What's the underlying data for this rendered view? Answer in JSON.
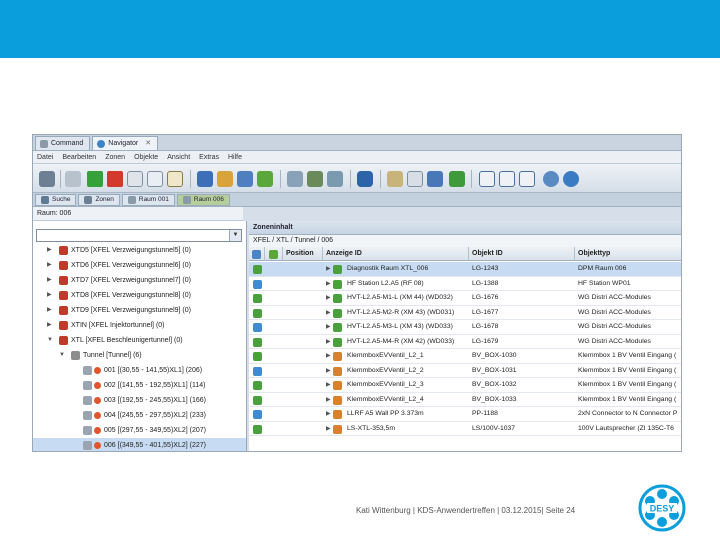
{
  "window_tabs": [
    {
      "label": "Command",
      "active": false
    },
    {
      "label": "Navigator",
      "active": true
    }
  ],
  "menu": [
    "Datei",
    "Bearbeiten",
    "Zonen",
    "Objekte",
    "Ansicht",
    "Extras",
    "Hilfe"
  ],
  "view_tabs": [
    {
      "label": "Suche",
      "active": false
    },
    {
      "label": "Zonen",
      "active": false
    },
    {
      "label": "Raum 001",
      "active": false
    },
    {
      "label": "Raum 006",
      "active": true
    }
  ],
  "breadcrumb": "Raum: 006",
  "tree": [
    {
      "label": "XTD5 [XFEL Verzweigungstunnel5] (0)",
      "level": 0,
      "expanded": false,
      "selected": false
    },
    {
      "label": "XTD6 [XFEL Verzweigungstunnel6] (0)",
      "level": 0,
      "expanded": false,
      "selected": false
    },
    {
      "label": "XTD7 [XFEL Verzweigungstunnel7] (0)",
      "level": 0,
      "expanded": false,
      "selected": false
    },
    {
      "label": "XTD8 [XFEL Verzweigungstunnel8] (0)",
      "level": 0,
      "expanded": false,
      "selected": false
    },
    {
      "label": "XTD9 [XFEL Verzweigungstunnel9] (0)",
      "level": 0,
      "expanded": false,
      "selected": false
    },
    {
      "label": "XTIN [XFEL Injektortunnel] (0)",
      "level": 0,
      "expanded": false,
      "selected": false
    },
    {
      "label": "XTL [XFEL Beschleunigertunnel] (0)",
      "level": 0,
      "expanded": true,
      "selected": false
    },
    {
      "label": "Tunnel [Tunnel] (6)",
      "level": 1,
      "expanded": true,
      "selected": false
    },
    {
      "label": "001 [(30,55 - 141,55)XL1] (206)",
      "level": 2,
      "expanded": false,
      "selected": false
    },
    {
      "label": "002 [(141,55 - 192,55)XL1] (114)",
      "level": 2,
      "expanded": false,
      "selected": false
    },
    {
      "label": "003 [(192,55 - 245,55)XL1] (166)",
      "level": 2,
      "expanded": false,
      "selected": false
    },
    {
      "label": "004 [(245,55 - 297,55)XL2] (233)",
      "level": 2,
      "expanded": false,
      "selected": false
    },
    {
      "label": "005 [(297,55 - 349,55)XL2] (207)",
      "level": 2,
      "expanded": false,
      "selected": false
    },
    {
      "label": "006 [(349,55 - 401,55)XL2] (227)",
      "level": 2,
      "expanded": false,
      "selected": true
    }
  ],
  "zone": {
    "title": "Zoneninhalt",
    "path": "XFEL / XTL / Tunnel / 006",
    "columns": [
      "Position",
      "Anzeige ID",
      "Objekt ID",
      "Objekttyp"
    ],
    "rows": [
      {
        "anzeige": "Diagnostik Raum XTL_006",
        "objekt": "LG-1243",
        "typ": "DPM Raum 006",
        "icon": "cube-green",
        "selected": true
      },
      {
        "anzeige": "HF Station L2.A5 (RF 08)",
        "objekt": "LG-1388",
        "typ": "HF Station WP01",
        "icon": "cube-green",
        "selected": false
      },
      {
        "anzeige": "HVT-L2.A5-M1-L (XM 44) (WD032)",
        "objekt": "LG-1676",
        "typ": "WG Distri ACC-Modules",
        "icon": "cube-green",
        "selected": false
      },
      {
        "anzeige": "HVT-L2.A5-M2-R (XM 43) (WD031)",
        "objekt": "LG-1677",
        "typ": "WG Distri ACC-Modules",
        "icon": "cube-green",
        "selected": false
      },
      {
        "anzeige": "HVT-L2.A5-M3-L (XM 43) (WD033)",
        "objekt": "LG-1678",
        "typ": "WG Distri ACC-Modules",
        "icon": "cube-green",
        "selected": false
      },
      {
        "anzeige": "HVT-L2.A5-M4-R (XM 42) (WD033)",
        "objekt": "LG-1679",
        "typ": "WG Distri ACC-Modules",
        "icon": "cube-green",
        "selected": false
      },
      {
        "anzeige": "KlemmboxEVVentil_L2_1",
        "objekt": "BV_BOX-1030",
        "typ": "Klemmbox 1 BV Ventil Eingang (",
        "icon": "box-orange",
        "selected": false
      },
      {
        "anzeige": "KlemmboxEVVentil_L2_2",
        "objekt": "BV_BOX-1031",
        "typ": "Klemmbox 1 BV Ventil Eingang (",
        "icon": "box-orange",
        "selected": false
      },
      {
        "anzeige": "KlemmboxEVVentil_L2_3",
        "objekt": "BV_BOX-1032",
        "typ": "Klemmbox 1 BV Ventil Eingang (",
        "icon": "box-orange",
        "selected": false
      },
      {
        "anzeige": "KlemmboxEVVentil_L2_4",
        "objekt": "BV_BOX-1033",
        "typ": "Klemmbox 1 BV Ventil Eingang (",
        "icon": "box-orange",
        "selected": false
      },
      {
        "anzeige": "LLRF A5 Wall PP 3.373m",
        "objekt": "PP-1188",
        "typ": "2xN Connector to N Connector P",
        "icon": "box-orange",
        "selected": false
      },
      {
        "anzeige": "LS-XTL-353,5m",
        "objekt": "LS/100V-1037",
        "typ": "100V Lautsprecher (ZI 135C-T6",
        "icon": "box-orange",
        "selected": false
      }
    ]
  },
  "footer": "Kati Wittenburg | KDS-Anwendertreffen | 03.12.2015| Seite 24",
  "logo_text": "DESY",
  "colors": {
    "header_blue": "#0a9edc",
    "selection": "#c7dcf2",
    "accent_green": "#5aa83c"
  }
}
